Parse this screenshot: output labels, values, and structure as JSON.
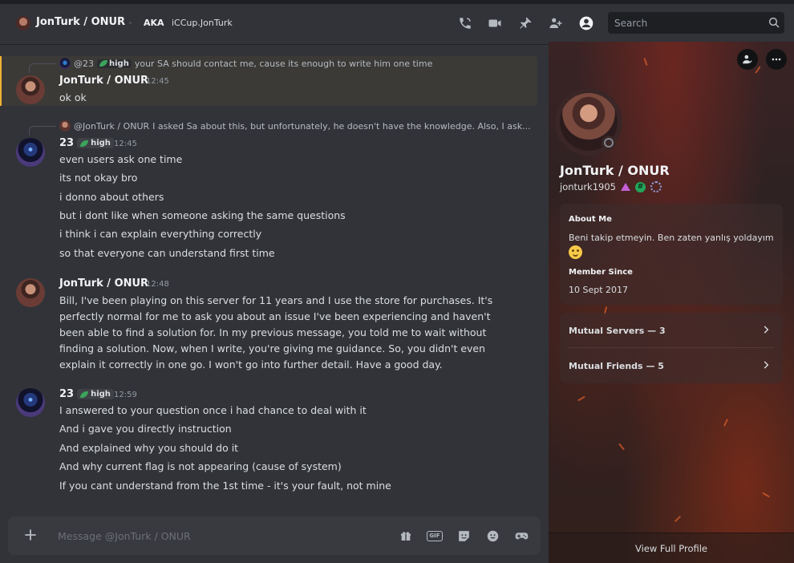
{
  "header": {
    "dm_name": "JonTurk / ONUR",
    "aka_label": "AKA",
    "aka_name": "iCCup.JonTurk",
    "search_placeholder": "Search",
    "icons": [
      "phone-call-icon",
      "video-call-icon",
      "pin-icon",
      "add-friends-icon",
      "user-profile-icon",
      "search-icon"
    ]
  },
  "messages": [
    {
      "reply": {
        "user": "@23",
        "tag": "high",
        "text": "your SA should contact me, cause its enough to write him one time"
      },
      "author": "JonTurk / ONUR",
      "time": "12:45",
      "lines": [
        "ok ok"
      ]
    },
    {
      "reply": {
        "user": "@JonTurk / ONUR",
        "text": "I asked Sa about this, but unfortunately, he doesn't have the knowledge. Also, I ask..."
      },
      "author": "23",
      "tag": "high",
      "time": "12:45",
      "lines": [
        "even users ask one time",
        "its not okay bro",
        "i donno about others",
        "but i dont like when someone asking the same questions",
        "i think i can explain everything correctly",
        "so that everyone can understand first time"
      ]
    },
    {
      "author": "JonTurk / ONUR",
      "time": "12:48",
      "paragraph": "Bill, I've been playing on this server for 11 years and I use the store for purchases. It's perfectly normal for me to ask you about an issue I've been experiencing and haven't been able to find a solution for. In my previous message, you told me to wait without finding a solution. Now, when I write, you're giving me guidance. So, you didn't even explain it correctly in one go. I won't go into further detail. Have a good day."
    },
    {
      "author": "23",
      "tag": "high",
      "time": "12:59",
      "lines": [
        "I answered to your question once i had chance to deal with it",
        "And i gave you directly instruction",
        "And explained why you should do it",
        "And why current flag is not appearing (cause of system)",
        "If you cant understand from the 1st time - it's your fault, not mine"
      ]
    }
  ],
  "composer": {
    "placeholder": "Message @JonTurk / ONUR",
    "gif_label": "GIF",
    "icons": [
      "add-attachment-icon",
      "gift-icon",
      "gif-icon",
      "sticker-icon",
      "emoji-icon",
      "activity-icon"
    ]
  },
  "profile": {
    "display_name": "JonTurk / ONUR",
    "username": "jonturk1905",
    "badges": [
      "hypesquad-badge",
      "active-developer-badge",
      "nitro-boost-badge"
    ],
    "about_label": "About Me",
    "about_text": "Beni takip etmeyin. Ben zaten yanlış yoldayım",
    "member_since_label": "Member Since",
    "member_since": "10 Sept 2017",
    "mutual_servers": "Mutual Servers — 3",
    "mutual_friends": "Mutual Friends — 5",
    "view_full": "View Full Profile",
    "status": "offline"
  },
  "colors": {
    "background": "#313338",
    "accent_mention": "#f0b232",
    "role_green": "#3ba55c"
  }
}
